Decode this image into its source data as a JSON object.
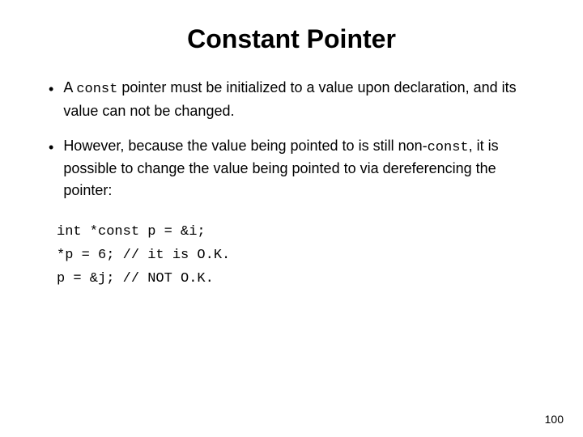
{
  "slide": {
    "title": "Constant Pointer",
    "bullets": [
      {
        "id": "bullet-1",
        "parts": [
          {
            "type": "text",
            "content": "A "
          },
          {
            "type": "code",
            "content": "const"
          },
          {
            "type": "text",
            "content": " pointer must be initialized to a value upon declaration, and its value can not be changed."
          }
        ]
      },
      {
        "id": "bullet-2",
        "parts": [
          {
            "type": "text",
            "content": "However, because the value being pointed to is still non-"
          },
          {
            "type": "code",
            "content": "const"
          },
          {
            "type": "text",
            "content": ", it is possible to change the value being pointed to via dereferencing the pointer:"
          }
        ]
      }
    ],
    "code_block": [
      {
        "line": "int *const p = &i;"
      },
      {
        "line": "*p = 6;      // it is O.K."
      },
      {
        "line": "p = &j;      // NOT O.K."
      }
    ],
    "page_number": "100"
  }
}
